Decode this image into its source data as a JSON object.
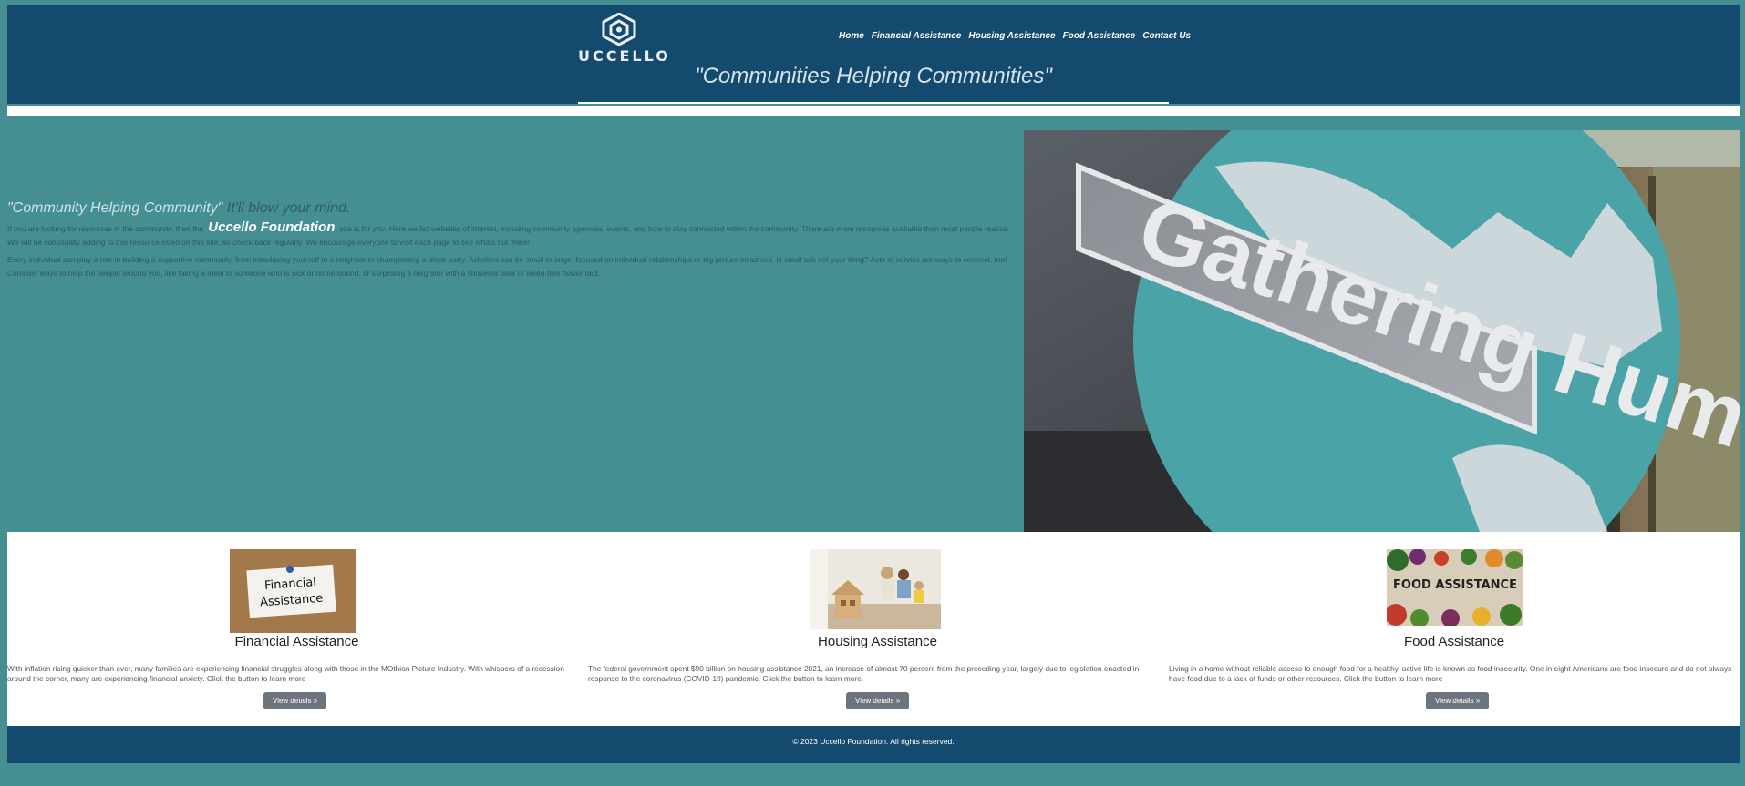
{
  "header": {
    "logo_text": "UCCELLO",
    "nav": [
      "Home",
      "Financial Assistance",
      "Housing Assistance",
      "Food Assistance",
      "Contact Us"
    ],
    "tagline": "\"Communities Helping Communities\""
  },
  "hero": {
    "heading_quote": "\"Community Helping Community\"",
    "heading_sub": " It'll blow your mind.",
    "p1_before": "If you are looking for resources in the community, then the",
    "p1_brand": "Uccello Foundation",
    "p1_after": "site is for you. Here we list websites of interest, including community agencies, events, and how to stay connected within the community. There are more resources available than most people realize. We will be continually adding to this resource listed on this site, so check back regularly. We encourage everyone to visit each page to see whats out there!",
    "p2": "Every individual can play a role in building a supportive community, from introducing yourself to a neighbor to championing a block party. Activities can be small or large, focused on individual relationships or big picture initiatives. Is small talk not your thing? Acts of service are ways to connect, too! Consider ways to help the people around you, like taking a meal to someone who is sick or home-bound, or surprising a neighbor with a shoveled walk or weed-free flower bed.",
    "image_sign_text": "Gathering Humanity"
  },
  "cards": [
    {
      "title": "Financial Assistance",
      "img_note": "Financial Assistance",
      "text": "With inflation rising quicker than ever, many families are experiencing financial struggles along with those in the MOthion Picture Industry. With whispers of a recession around the corner, many are experiencing financial anxiety. Click the button to learn more",
      "button": "View details »"
    },
    {
      "title": "Housing Assistance",
      "text": "The federal government spent $90 billion on housing assistance 2021, an increase of almost 70 percent from the preceding year, largely due to legislation enacted in response to the coronavirus (COVID-19) pandemic. Click the button to learn more.",
      "button": "View details »"
    },
    {
      "title": "Food Assistance",
      "img_note": "FOOD ASSISTANCE",
      "text": "Living in a home without reliable access to enough food for a healthy, active life is known as food insecurity. One in eight Americans are food insecure and do not always have food due to a lack of funds or other resources. Click the button to learn more",
      "button": "View details »"
    }
  ],
  "footer": {
    "text": "© 2023 Uccello Foundation. All rights reserved."
  },
  "colors": {
    "page_bg": "#458f93",
    "header_bg": "#144a6e",
    "button_bg": "#6c757d"
  }
}
